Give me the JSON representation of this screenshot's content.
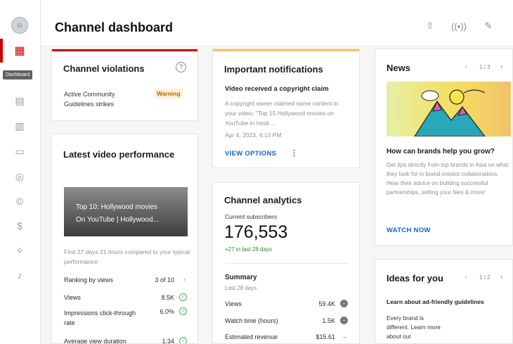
{
  "header": {
    "title": "Channel dashboard",
    "icons": [
      "upload-icon",
      "live-icon",
      "edit-icon"
    ]
  },
  "sidebar": {
    "tooltip": "Dashboard",
    "items": [
      "dashboard",
      "content",
      "analytics",
      "comments",
      "subtitles",
      "copyright",
      "earn",
      "customization",
      "audio-library"
    ]
  },
  "violations": {
    "title": "Channel violations",
    "label": "Active Community Guidelines strikes",
    "status": "Warning"
  },
  "notifications": {
    "title": "Important notifications",
    "heading": "Video received a copyright claim",
    "body": "A copyright owner claimed some content in your video, \"Top 15 Hollywood movies on YouTube in hindi ...",
    "date": "Apr 4, 2023, 4:13 PM",
    "action": "VIEW OPTIONS"
  },
  "news": {
    "title": "News",
    "pager": "1 / 3",
    "headline": "How can brands help you grow?",
    "body": "Get tips directly from top brands in Asia on what they look for in brand-creator collaborations. Hear their advice on building successful partnerships, setting your fees & more!",
    "action": "WATCH NOW"
  },
  "latest": {
    "title": "Latest video performance",
    "video_title_line1": "Top 10: Hollywood movies",
    "video_title_line2": "On YouTube | Hollywood...",
    "compare": "First 27 days 21 hours compared to your typical performance:",
    "rows": [
      {
        "label": "Ranking by views",
        "value": "3 of 10"
      },
      {
        "label": "Views",
        "value": "8.5K"
      },
      {
        "label": "Impressions click-through rate",
        "value": "6.0%"
      },
      {
        "label": "Average view duration",
        "value": "1:34"
      }
    ]
  },
  "analytics": {
    "title": "Channel analytics",
    "subs_label": "Current subscribers",
    "subs_value": "176,553",
    "subs_delta": "+27 in last 28 days",
    "summary_title": "Summary",
    "summary_period": "Last 28 days",
    "rows": [
      {
        "label": "Views",
        "value": "59.4K"
      },
      {
        "label": "Watch time (hours)",
        "value": "1.5K"
      },
      {
        "label": "Estimated revenue",
        "value": "$15.61"
      }
    ]
  },
  "ideas": {
    "title": "Ideas for you",
    "pager": "1 / 2",
    "heading": "Learn about ad-friendly guidelines",
    "body": "Every brand is different. Learn more about our"
  },
  "colors": {
    "accent": "#cc0000",
    "notify_accent": "#f3c84b",
    "link": "#1565c0",
    "positive": "#4caf50"
  }
}
